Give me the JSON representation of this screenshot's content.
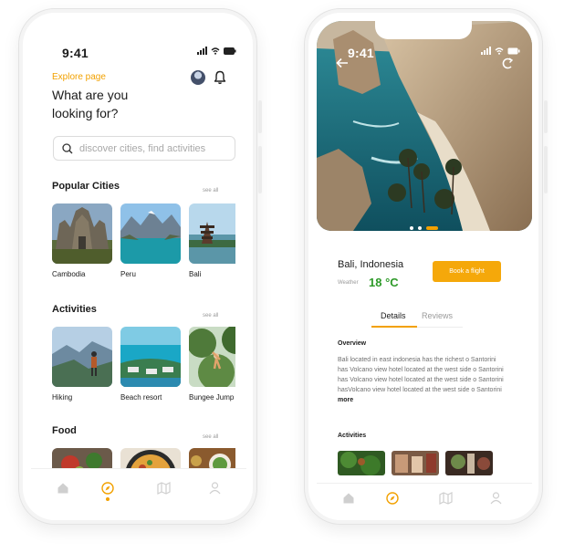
{
  "status": {
    "time": "9:41"
  },
  "explore": {
    "subtitle": "Explore page",
    "title_line1": "What are you",
    "title_line2": "looking for?",
    "search": {
      "placeholder": "discover cities, find activities"
    },
    "sections": [
      {
        "title": "Popular Cities",
        "see_all": "see all",
        "items": [
          {
            "label": "Cambodia"
          },
          {
            "label": "Peru"
          },
          {
            "label": "Bali"
          }
        ]
      },
      {
        "title": "Activities",
        "see_all": "see all",
        "items": [
          {
            "label": "Hiking"
          },
          {
            "label": "Beach resort"
          },
          {
            "label": "Bungee Jump"
          }
        ]
      },
      {
        "title": "Food",
        "see_all": "see all",
        "items": [
          {
            "label": ""
          },
          {
            "label": ""
          },
          {
            "label": ""
          }
        ]
      }
    ],
    "nav": [
      {
        "icon": "home-icon"
      },
      {
        "icon": "compass-icon",
        "active": true
      },
      {
        "icon": "map-icon"
      },
      {
        "icon": "user-icon"
      }
    ]
  },
  "detail": {
    "place": "Bali, Indonesia",
    "weather_label": "Weather",
    "temperature": "18 °C",
    "book_label": "Book a flight",
    "tabs": [
      {
        "label": "Details",
        "active": true
      },
      {
        "label": "Reviews",
        "active": false
      }
    ],
    "overview_title": "Overview",
    "overview_text": "Bali located in east indonesia has the richest o Santorini has Volcano view hotel located at the west side o Santorini has Volcano view hotel located at the west side o Santorini hasVolcano view hotel located at the west side o Santorini",
    "more_label": "more",
    "activities_title": "Activities",
    "carousel": {
      "count": 3,
      "active_index": 2
    },
    "nav": [
      {
        "icon": "home-icon"
      },
      {
        "icon": "compass-icon",
        "active": true
      },
      {
        "icon": "map-icon"
      },
      {
        "icon": "user-icon"
      }
    ]
  },
  "colors": {
    "accent": "#f2a100",
    "button": "#f5a80a",
    "temperature": "#2e9a29"
  }
}
